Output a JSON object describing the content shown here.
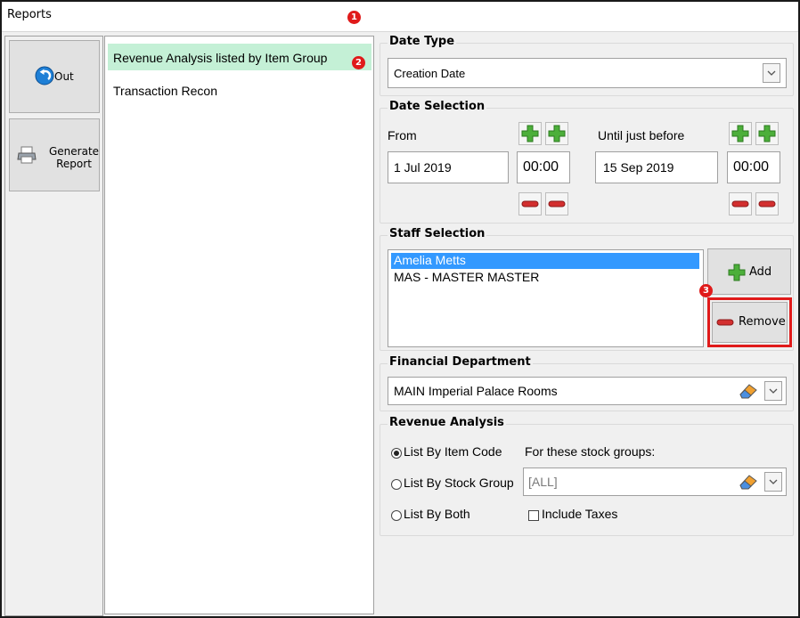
{
  "window": {
    "title": "Reports"
  },
  "badges": {
    "b1": "1",
    "b2": "2",
    "b3": "3"
  },
  "colors": {
    "accent_selected": "#c4f0d6",
    "badge_red": "#e01a1a",
    "highlight_box": "#e01a1a",
    "list_select_blue": "#3399ff"
  },
  "left_buttons": {
    "out_label": "Out",
    "generate_label": "Generate Report",
    "generate_line1": "Generate",
    "generate_line2": "Report"
  },
  "reports": [
    {
      "label": "Revenue Analysis listed by Item Group",
      "selected": true
    },
    {
      "label": "Transaction Recon",
      "selected": false
    }
  ],
  "date_type": {
    "title": "Date Type",
    "value": "Creation Date"
  },
  "date_selection": {
    "title": "Date Selection",
    "from_label": "From",
    "from_date": "1 Jul 2019",
    "from_time": "00:00",
    "until_label": "Until just before",
    "until_date": "15 Sep 2019",
    "until_time": "00:00"
  },
  "staff_selection": {
    "title": "Staff Selection",
    "items": [
      {
        "label": "Amelia Metts",
        "selected": true
      },
      {
        "label": "MAS - MASTER MASTER",
        "selected": false
      }
    ],
    "add_label": "Add",
    "remove_label": "Remove"
  },
  "financial_department": {
    "title": "Financial Department",
    "value": "MAIN Imperial Palace Rooms"
  },
  "revenue_analysis": {
    "title": "Revenue Analysis",
    "option_item_code": "List By Item Code",
    "option_stock_group": "List By Stock Group",
    "option_both": "List By Both",
    "selected_option": "List By Item Code",
    "stock_groups_label": "For these stock groups:",
    "stock_groups_value": "[ALL]",
    "include_taxes_label": "Include Taxes",
    "include_taxes_checked": false
  },
  "icons": {
    "out": "back-arrow-icon",
    "generate": "printer-icon",
    "plus": "plus-icon",
    "minus": "minus-icon",
    "eraser": "eraser-icon",
    "dropdown": "chevron-down-icon"
  }
}
